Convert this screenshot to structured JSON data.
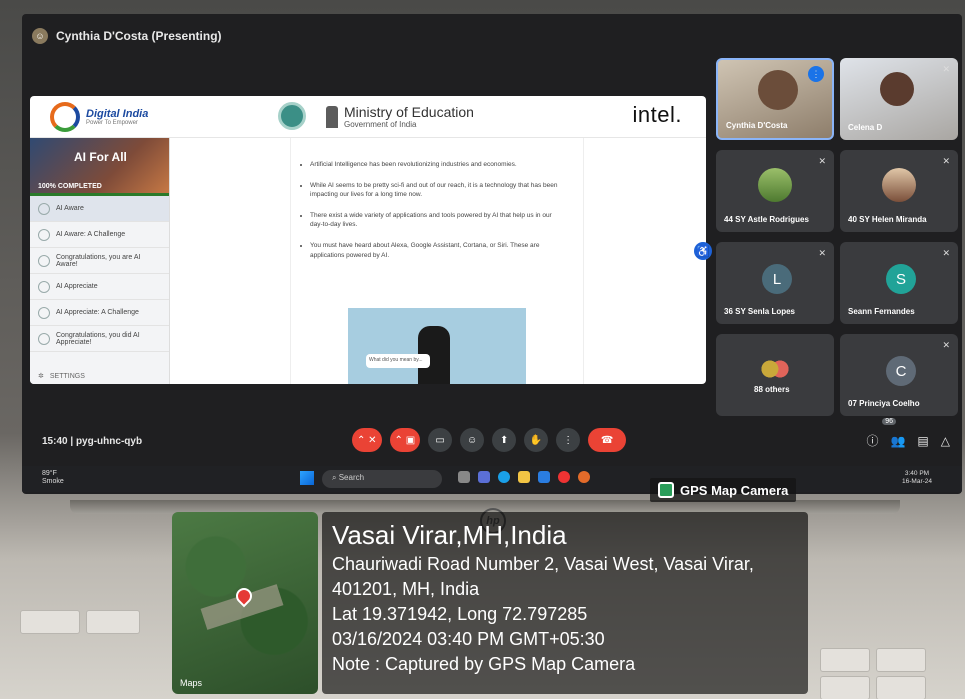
{
  "meeting": {
    "presenter": "Cynthia D'Costa (Presenting)",
    "time": "15:40",
    "separator": "|",
    "code": "pyg-uhnc-qyb",
    "people_count": "96"
  },
  "slide": {
    "logo_text": "Digital India",
    "logo_sub": "Power To Empower",
    "ministry": "Ministry of Education",
    "government": "Government of India",
    "intel": "intel.",
    "course_title": "AI For All",
    "progress_label": "100% COMPLETED",
    "progress": 1.0,
    "menu_items": [
      "AI Aware",
      "AI Aware: A Challenge",
      "Congratulations, you are AI Aware!",
      "AI Appreciate",
      "AI Appreciate: A Challenge",
      "Congratulations, you did AI Appreciate!"
    ],
    "settings": "SETTINGS",
    "bullets": [
      "Artificial Intelligence has been revolutionizing industries and economies.",
      "While AI seems to be pretty sci-fi and out of our reach, it is a technology that has been impacting our lives for a long time now.",
      "There exist a wide variety of applications and tools powered by AI that help us in our day-to-day lives.",
      "You must have heard about Alexa, Google Assistant, Cortana, or Siri. These are applications powered by AI."
    ],
    "speaker_bubble": "What did you mean by..."
  },
  "participants": [
    {
      "name": "Cynthia D'Costa",
      "initial": ""
    },
    {
      "name": "Celena D",
      "initial": ""
    },
    {
      "name": "44 SY Astle Rodrigues",
      "initial": ""
    },
    {
      "name": "40 SY Helen Miranda",
      "initial": ""
    },
    {
      "name": "36 SY Senla Lopes",
      "initial": "L"
    },
    {
      "name": "Seann Fernandes",
      "initial": "S"
    },
    {
      "name": "88 others",
      "initial": ""
    },
    {
      "name": "07 Princiya Coelho",
      "initial": "C"
    }
  ],
  "taskbar": {
    "temp": "89°F",
    "weather": "Smoke",
    "search": "Search",
    "time": "3:40 PM",
    "date": "16-Mar-24"
  },
  "gps": {
    "app": "GPS Map Camera",
    "place": "Vasai Virar,MH,India",
    "address": "Chauriwadi Road Number 2, Vasai West, Vasai Virar, 401201, MH, India",
    "coords": "Lat 19.371942, Long 72.797285",
    "datetime": "03/16/2024 03:40 PM GMT+05:30",
    "note": "Note : Captured by GPS Map Camera",
    "maps_label": "Maps"
  },
  "laptop": {
    "brand": "hp"
  },
  "colors": {
    "accent": "#8ab4f8",
    "end_call": "#ea4335",
    "avatar_l": "#4a6b7a",
    "avatar_s": "#21a398",
    "avatar_c": "#5f6a76"
  }
}
